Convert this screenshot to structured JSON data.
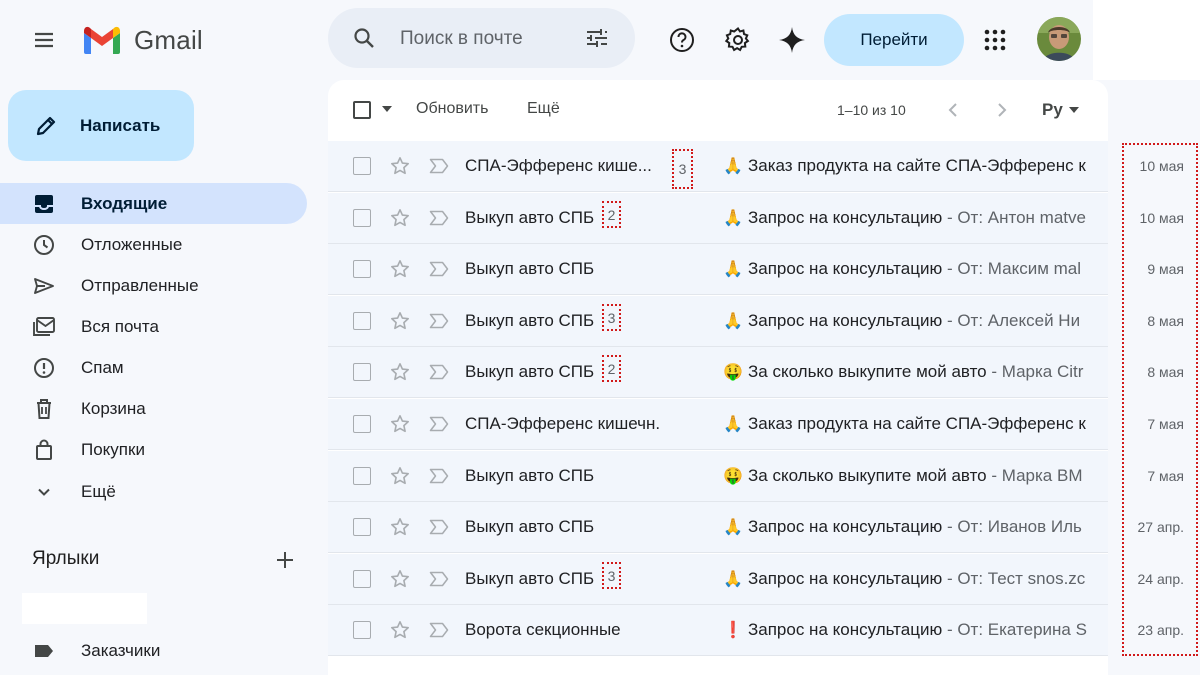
{
  "header": {
    "app_name": "Gmail",
    "search_placeholder": "Поиск в почте",
    "goto_label": "Перейти",
    "icons": [
      "menu-icon",
      "search-icon",
      "tune-icon",
      "help-icon",
      "settings-icon",
      "gemini-icon",
      "apps-icon"
    ]
  },
  "compose": {
    "label": "Написать"
  },
  "sidebar": {
    "items": [
      {
        "label": "Входящие",
        "icon": "inbox-icon",
        "active": true
      },
      {
        "label": "Отложенные",
        "icon": "clock-icon"
      },
      {
        "label": "Отправленные",
        "icon": "send-icon"
      },
      {
        "label": "Вся почта",
        "icon": "all-mail-icon"
      },
      {
        "label": "Спам",
        "icon": "spam-icon"
      },
      {
        "label": "Корзина",
        "icon": "trash-icon"
      },
      {
        "label": "Покупки",
        "icon": "shopping-bag-icon"
      },
      {
        "label": "Ещё",
        "icon": "chevron-down-icon"
      }
    ],
    "labels_title": "Ярлыки",
    "labels": [
      {
        "label": "Заказчики",
        "icon": "label-icon"
      }
    ]
  },
  "toolbar": {
    "refresh_label": "Обновить",
    "more_label": "Ещё",
    "pager": "1–10 из 10",
    "lang": "Ру"
  },
  "emails": [
    {
      "sender": "СПА-Эфференс кише...",
      "count": "3",
      "emoji": "🙏",
      "subject": "Заказ продукта на сайте СПА-Эфференс к",
      "snippet": "",
      "date": "10 мая"
    },
    {
      "sender": "Выкуп авто СПБ",
      "count": "2",
      "emoji": "🙏",
      "subject": "Запрос на консультацию",
      "snippet": " - От: Антон matve",
      "date": "10 мая"
    },
    {
      "sender": "Выкуп авто СПБ",
      "count": "",
      "emoji": "🙏",
      "subject": "Запрос на консультацию",
      "snippet": " - От: Максим mal",
      "date": "9 мая"
    },
    {
      "sender": "Выкуп авто СПБ",
      "count": "3",
      "emoji": "🙏",
      "subject": "Запрос на консультацию",
      "snippet": " - От: Алексей Ни",
      "date": "8 мая"
    },
    {
      "sender": "Выкуп авто СПБ",
      "count": "2",
      "emoji": "🤑",
      "subject": "За сколько выкупите мой авто",
      "snippet": " - Марка Citr",
      "date": "8 мая"
    },
    {
      "sender": "СПА-Эфференс кишечн.",
      "count": "",
      "emoji": "🙏",
      "subject": "Заказ продукта на сайте СПА-Эфференс к",
      "snippet": "",
      "date": "7 мая"
    },
    {
      "sender": "Выкуп авто СПБ",
      "count": "",
      "emoji": "🤑",
      "subject": "За сколько выкупите мой авто",
      "snippet": " - Марка BM",
      "date": "7 мая"
    },
    {
      "sender": "Выкуп авто СПБ",
      "count": "",
      "emoji": "🙏",
      "subject": "Запрос на консультацию",
      "snippet": " - От: Иванов Иль",
      "date": "27 апр."
    },
    {
      "sender": "Выкуп авто СПБ",
      "count": "3",
      "emoji": "🙏",
      "subject": "Запрос на консультацию",
      "snippet": " - От: Тест snos.zc",
      "date": "24 апр."
    },
    {
      "sender": "Ворота секционные",
      "count": "",
      "emoji": "❗",
      "subject": "Запрос на консультацию",
      "snippet": " - От: Екатерина S",
      "date": "23 апр."
    }
  ],
  "colors": {
    "accent": "#c2e7ff",
    "active_nav": "#d3e3fd",
    "highlight": "#d11a1a"
  }
}
